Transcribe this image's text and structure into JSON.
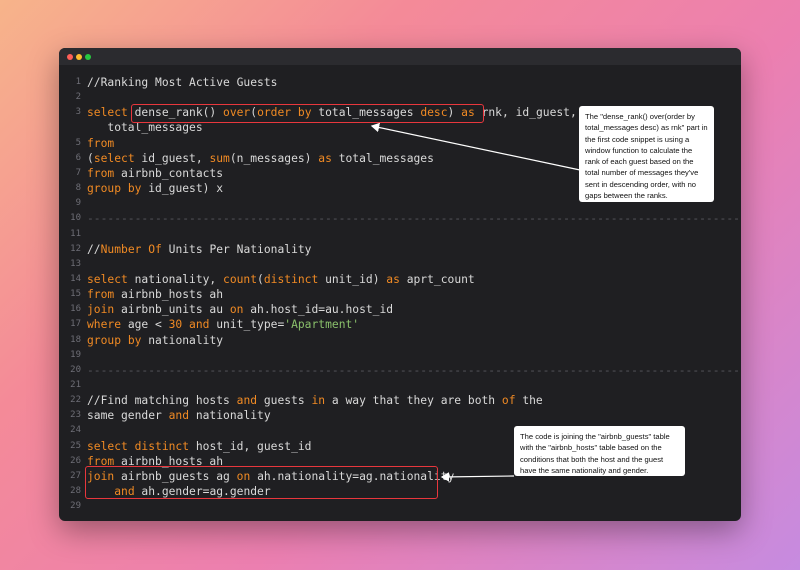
{
  "window": {
    "controls": [
      "close",
      "minimize",
      "maximize"
    ]
  },
  "lines": [
    {
      "n": "1",
      "html": "//Ranking Most Active Guests"
    },
    {
      "n": "2",
      "html": ""
    },
    {
      "n": "3",
      "html": "<span class='kw'>select</span> dense_rank() <span class='kw'>over</span>(<span class='kw'>order</span> <span class='kw'>by</span> total_messages <span class='kw'>desc</span>) <span class='kw'>as</span> rnk, id_guest,"
    },
    {
      "n": "",
      "html": "   total_messages"
    },
    {
      "n": "5",
      "html": "<span class='kw'>from</span>"
    },
    {
      "n": "6",
      "html": "(<span class='kw'>select</span> id_guest, <span class='kw'>sum</span>(n_messages) <span class='kw'>as</span> total_messages"
    },
    {
      "n": "7",
      "html": "<span class='kw'>from</span> airbnb_contacts"
    },
    {
      "n": "8",
      "html": "<span class='kw'>group</span> <span class='kw'>by</span> id_guest) x"
    },
    {
      "n": "9",
      "html": ""
    },
    {
      "n": "10",
      "html": "<span class='dash'>-------------------------------------------------------------------------------------------------------------------------</span>"
    },
    {
      "n": "11",
      "html": ""
    },
    {
      "n": "12",
      "html": "//<span class='kw'>Number</span> <span class='kw'>Of</span> Units Per Nationality"
    },
    {
      "n": "13",
      "html": ""
    },
    {
      "n": "14",
      "html": "<span class='kw'>select</span> nationality, <span class='kw'>count</span>(<span class='kw'>distinct</span> unit_id) <span class='kw'>as</span> aprt_count"
    },
    {
      "n": "15",
      "html": "<span class='kw'>from</span> airbnb_hosts ah"
    },
    {
      "n": "16",
      "html": "<span class='kw'>join</span> airbnb_units au <span class='kw'>on</span> ah.host_id=au.host_id"
    },
    {
      "n": "17",
      "html": "<span class='kw'>where</span> age &lt; <span class='num'>30</span> <span class='kw'>and</span> unit_type=<span class='str'>'Apartment'</span>"
    },
    {
      "n": "18",
      "html": "<span class='kw'>group</span> <span class='kw'>by</span> nationality"
    },
    {
      "n": "19",
      "html": ""
    },
    {
      "n": "20",
      "html": "<span class='dash'>-------------------------------------------------------------------------------------------------------------------------</span>"
    },
    {
      "n": "21",
      "html": ""
    },
    {
      "n": "22",
      "html": "//Find matching hosts <span class='kw'>and</span> guests <span class='kw'>in</span> a way that they are both <span class='kw'>of</span> the"
    },
    {
      "n": "23",
      "html": "same gender <span class='kw'>and</span> nationality"
    },
    {
      "n": "24",
      "html": ""
    },
    {
      "n": "25",
      "html": "<span class='kw'>select</span> <span class='kw'>distinct</span> host_id, guest_id"
    },
    {
      "n": "26",
      "html": "<span class='kw'>from</span> airbnb_hosts ah"
    },
    {
      "n": "27",
      "html": "<span class='kw'>join</span> airbnb_guests ag <span class='kw'>on</span> ah.nationality=ag.nationality"
    },
    {
      "n": "28",
      "html": "    <span class='kw'>and</span> ah.gender=ag.gender"
    },
    {
      "n": "29",
      "html": ""
    }
  ],
  "callouts": {
    "first": "The \"dense_rank() over(order by total_messages desc) as rnk\" part in the first code snippet is using a window function to calculate the rank of each guest based on the total number of messages they've sent in descending order, with no gaps between the ranks.",
    "second": "The code is joining the \"airbnb_guests\" table with the \"airbnb_hosts\" table based on the conditions that both the host and the guest have the same nationality and gender."
  },
  "colors": {
    "keyword": "#f08a24",
    "string": "#8ac06b",
    "highlight": "#e8373d"
  }
}
